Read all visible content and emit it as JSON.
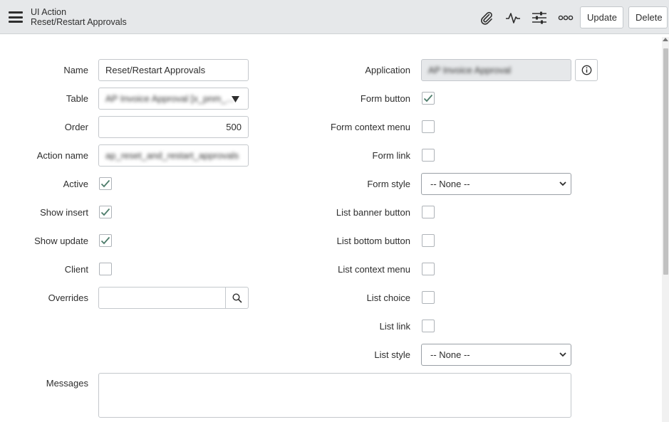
{
  "header": {
    "title": "UI Action",
    "subtitle": "Reset/Restart Approvals",
    "icons": [
      "menu-icon",
      "paperclip-icon",
      "activity-icon",
      "sliders-icon",
      "more-icon"
    ],
    "update_label": "Update",
    "delete_label": "Delete"
  },
  "form": {
    "name": {
      "label": "Name",
      "value": "Reset/Restart Approvals"
    },
    "table": {
      "label": "Table",
      "value": "AP Invoice Approval [x_pnm_...",
      "blurred": true
    },
    "order": {
      "label": "Order",
      "value": "500"
    },
    "action_name": {
      "label": "Action name",
      "value": "ap_reset_and_restart_approvals",
      "blurred": true
    },
    "active": {
      "label": "Active",
      "checked": true
    },
    "show_insert": {
      "label": "Show insert",
      "checked": true
    },
    "show_update": {
      "label": "Show update",
      "checked": true
    },
    "client": {
      "label": "Client",
      "checked": false
    },
    "overrides": {
      "label": "Overrides",
      "value": ""
    },
    "application": {
      "label": "Application",
      "value": "AP Invoice Approval",
      "blurred": true
    },
    "form_button": {
      "label": "Form button",
      "checked": true
    },
    "form_context_menu": {
      "label": "Form context menu",
      "checked": false
    },
    "form_link": {
      "label": "Form link",
      "checked": false
    },
    "form_style": {
      "label": "Form style",
      "value": "-- None --"
    },
    "list_banner_button": {
      "label": "List banner button",
      "checked": false
    },
    "list_bottom_button": {
      "label": "List bottom button",
      "checked": false
    },
    "list_context_menu": {
      "label": "List context menu",
      "checked": false
    },
    "list_choice": {
      "label": "List choice",
      "checked": false
    },
    "list_link": {
      "label": "List link",
      "checked": false
    },
    "list_style": {
      "label": "List style",
      "value": "-- None --"
    },
    "messages": {
      "label": "Messages",
      "value": ""
    }
  },
  "colors": {
    "check": "#4e7d6b",
    "header_bg": "#e6e8ea",
    "border": "#c4c8cc"
  }
}
